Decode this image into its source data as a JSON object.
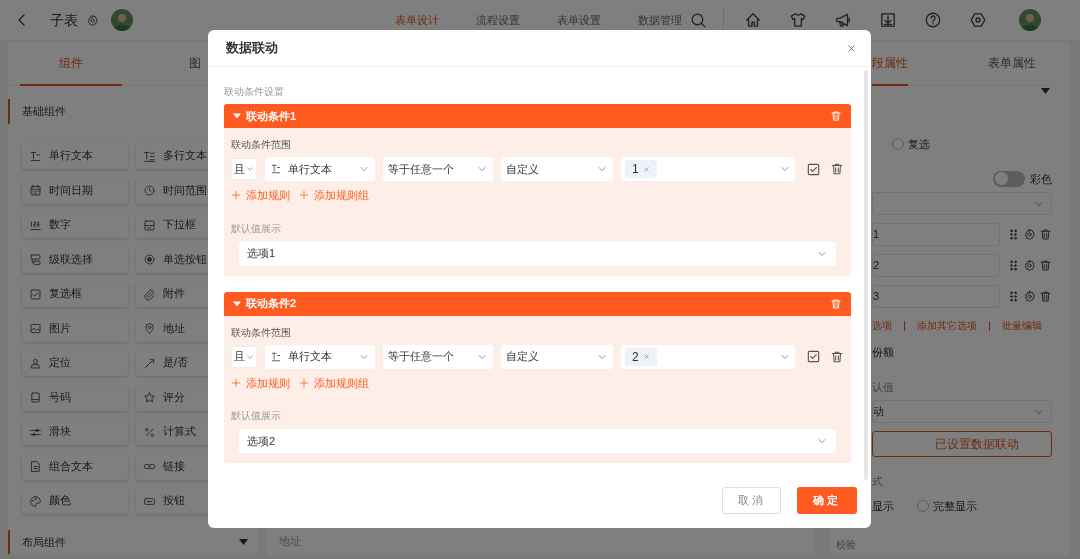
{
  "topbar": {
    "title": "子表",
    "nav": [
      {
        "label": "表单设计",
        "selected": true
      },
      {
        "label": "流程设置",
        "selected": false
      },
      {
        "label": "表单设置",
        "selected": false
      },
      {
        "label": "数据管理",
        "selected": false
      }
    ]
  },
  "left_panel": {
    "tabs": [
      {
        "label": "组件",
        "selected": true
      },
      {
        "label": "图",
        "selected": false
      }
    ],
    "section": "基础组件",
    "components": [
      "单行文本",
      "多行文本",
      "时间日期",
      "时间范围",
      "数字",
      "下拉框",
      "级联选择",
      "单选按钮",
      "复选框",
      "附件",
      "图片",
      "地址",
      "定位",
      "是/否",
      "号码",
      "评分",
      "滑块",
      "计算式",
      "组合文本",
      "链接",
      "颜色",
      "按钮"
    ],
    "footer_section": "布局组件"
  },
  "canvas": {
    "field_label": "地址"
  },
  "right_panel": {
    "tabs": [
      {
        "label": "段属性",
        "selected": true
      },
      {
        "label": "表单属性",
        "selected": false
      }
    ],
    "radio": {
      "label": "复选",
      "selected": false
    },
    "toggle": {
      "label": "彩色",
      "on": false
    },
    "options": [
      "1",
      "2",
      "3"
    ],
    "links": [
      "选项",
      "添加其它选项",
      "批量编辑"
    ],
    "quota_label": "份额",
    "default_label": "认值",
    "default_value": "动",
    "linkage_button": "已设置数据联动",
    "display_label": "式",
    "display_fragment": "显示",
    "display_radio": {
      "label": "完整显示",
      "selected": false
    },
    "validation_label": "校验"
  },
  "modal": {
    "title": "数据联动",
    "section_label": "联动条件设置",
    "conditions": [
      {
        "title": "联动条件1",
        "expanded": true,
        "range_label": "联动条件范围",
        "conjunction": "且",
        "field": "单行文本",
        "operator": "等于任意一个",
        "value_type": "自定义",
        "tags": [
          "1"
        ],
        "add_rule": "添加规则",
        "add_group": "添加规则组",
        "default_label": "默认值展示",
        "default_value": "选项1"
      },
      {
        "title": "联动条件2",
        "expanded": true,
        "range_label": "联动条件范围",
        "conjunction": "且",
        "field": "单行文本",
        "operator": "等于任意一个",
        "value_type": "自定义",
        "tags": [
          "2"
        ],
        "add_rule": "添加规则",
        "add_group": "添加规则组",
        "default_label": "默认值展示",
        "default_value": "选项2"
      }
    ],
    "cancel": "取消",
    "confirm": "确定"
  }
}
